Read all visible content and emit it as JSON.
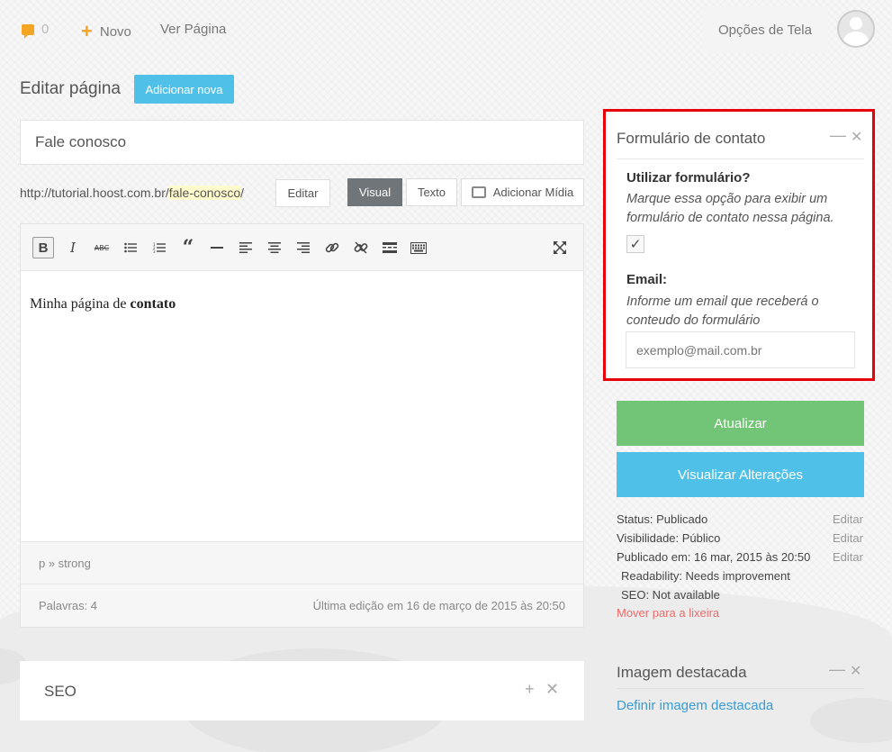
{
  "topbar": {
    "comment_count": "0",
    "new_label": "Novo",
    "view_page": "Ver Página",
    "screen_options": "Opções de Tela"
  },
  "header": {
    "title": "Editar página",
    "add_new": "Adicionar nova"
  },
  "post": {
    "title": "Fale conosco",
    "permalink_base": "http://tutorial.hoost.com.br/",
    "permalink_slug": "fale-conosco",
    "permalink_end": "/",
    "edit_label": "Editar"
  },
  "editor": {
    "tab_visual": "Visual",
    "tab_text": "Texto",
    "add_media": "Adicionar Mídia",
    "content_plain": "Minha página de ",
    "content_bold": "contato",
    "path": "p » strong",
    "word_count": "Palavras: 4",
    "last_edit": "Última edição em 16 de março de 2015 às 20:50",
    "toolbar": [
      "bold",
      "italic",
      "strikethrough",
      "bullet-list",
      "numbered-list",
      "blockquote",
      "horizontal-rule",
      "align-left",
      "align-center",
      "align-right",
      "link",
      "unlink",
      "read-more",
      "toolbar-toggle",
      "fullscreen"
    ]
  },
  "seo_box": {
    "title": "SEO"
  },
  "contact_box": {
    "title": "Formulário de contato",
    "use_label": "Utilizar formulário?",
    "use_help": "Marque essa opção para exibir um formulário de contato nessa página.",
    "checked": true,
    "email_label": "Email:",
    "email_help": "Informe um email que receberá o conteudo do formulário",
    "email_placeholder": "exemplo@mail.com.br",
    "highlight_color": "#e5000a"
  },
  "publish": {
    "update": "Atualizar",
    "preview": "Visualizar Alterações",
    "update_color": "#72c476",
    "preview_color": "#4fc1e9",
    "status": "Status: Publicado",
    "visibility": "Visibilidade: Público",
    "published_on": "Publicado em: 16 mar, 2015 às 20:50",
    "readability": "Readability: Needs improvement",
    "seo": "SEO: Not available",
    "edit": "Editar",
    "trash": "Mover para a lixeira"
  },
  "featured_image": {
    "title": "Imagem destacada",
    "link": "Definir imagem destacada"
  }
}
